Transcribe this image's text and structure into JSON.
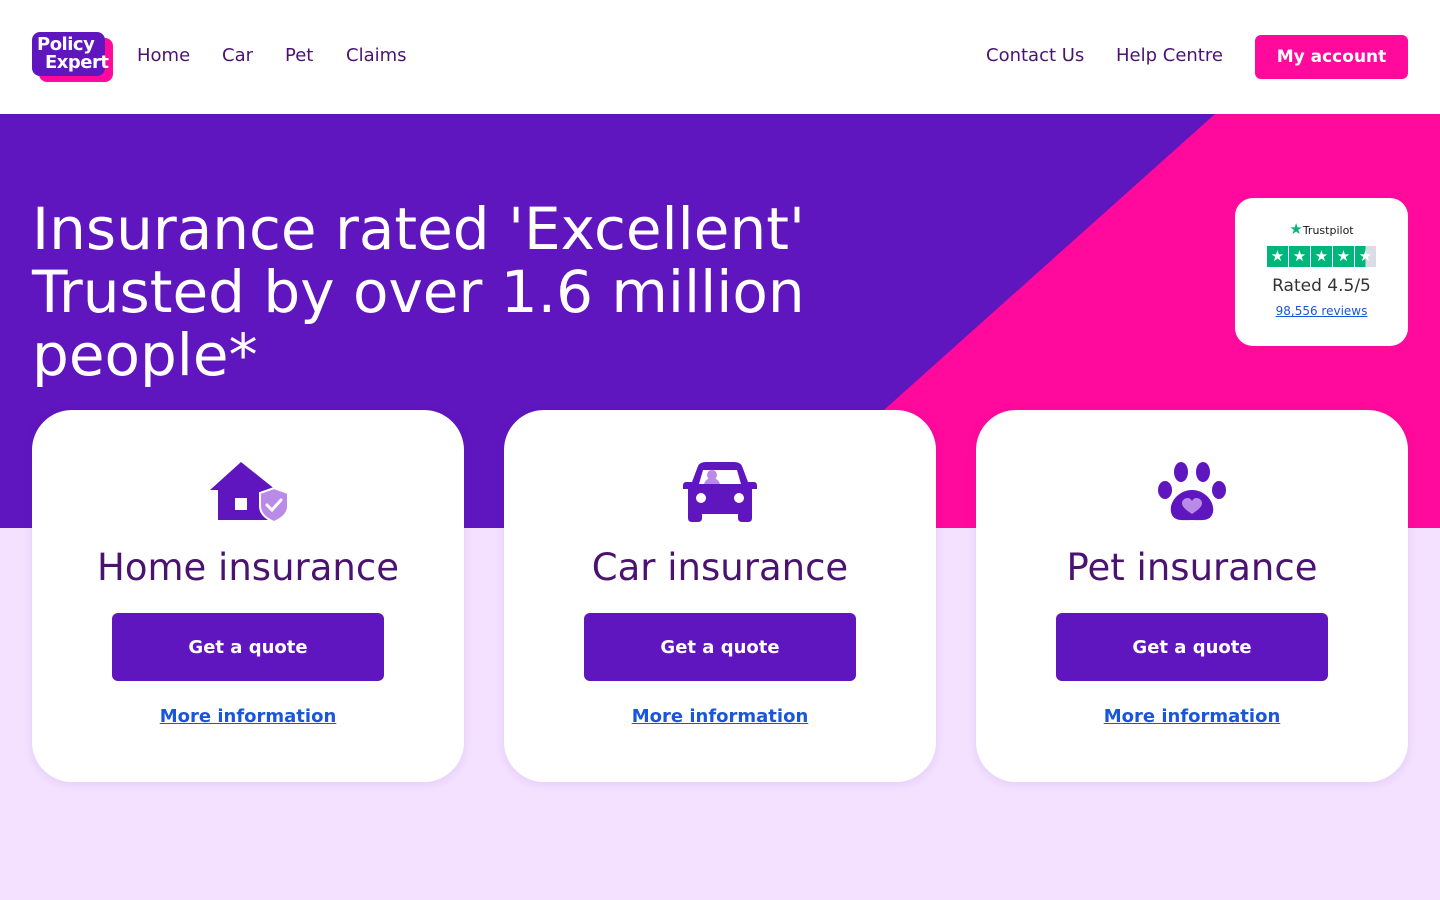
{
  "logo": {
    "line1": "Policy",
    "line2": "Expert"
  },
  "nav": {
    "left": [
      "Home",
      "Car",
      "Pet",
      "Claims"
    ],
    "right": [
      "Contact Us",
      "Help Centre"
    ],
    "account_label": "My account"
  },
  "hero": {
    "title_line1": "Insurance rated 'Excellent'",
    "title_line2": "Trusted by over 1.6 million people*"
  },
  "trustpilot": {
    "brand": "Trustpilot",
    "rating_text": "Rated 4.5/5",
    "reviews_text": "98,556 reviews",
    "stars": 4.5
  },
  "cards": [
    {
      "icon": "house-shield-icon",
      "title": "Home insurance",
      "button": "Get a quote",
      "link": "More information"
    },
    {
      "icon": "car-icon",
      "title": "Car insurance",
      "button": "Get a quote",
      "link": "More information"
    },
    {
      "icon": "paw-heart-icon",
      "title": "Pet insurance",
      "button": "Get a quote",
      "link": "More information"
    }
  ],
  "colors": {
    "purple": "#5f16be",
    "pink": "#ff0a9c",
    "lavender": "#f3e1ff",
    "dark_text": "#4a1370",
    "link": "#1a56db"
  }
}
